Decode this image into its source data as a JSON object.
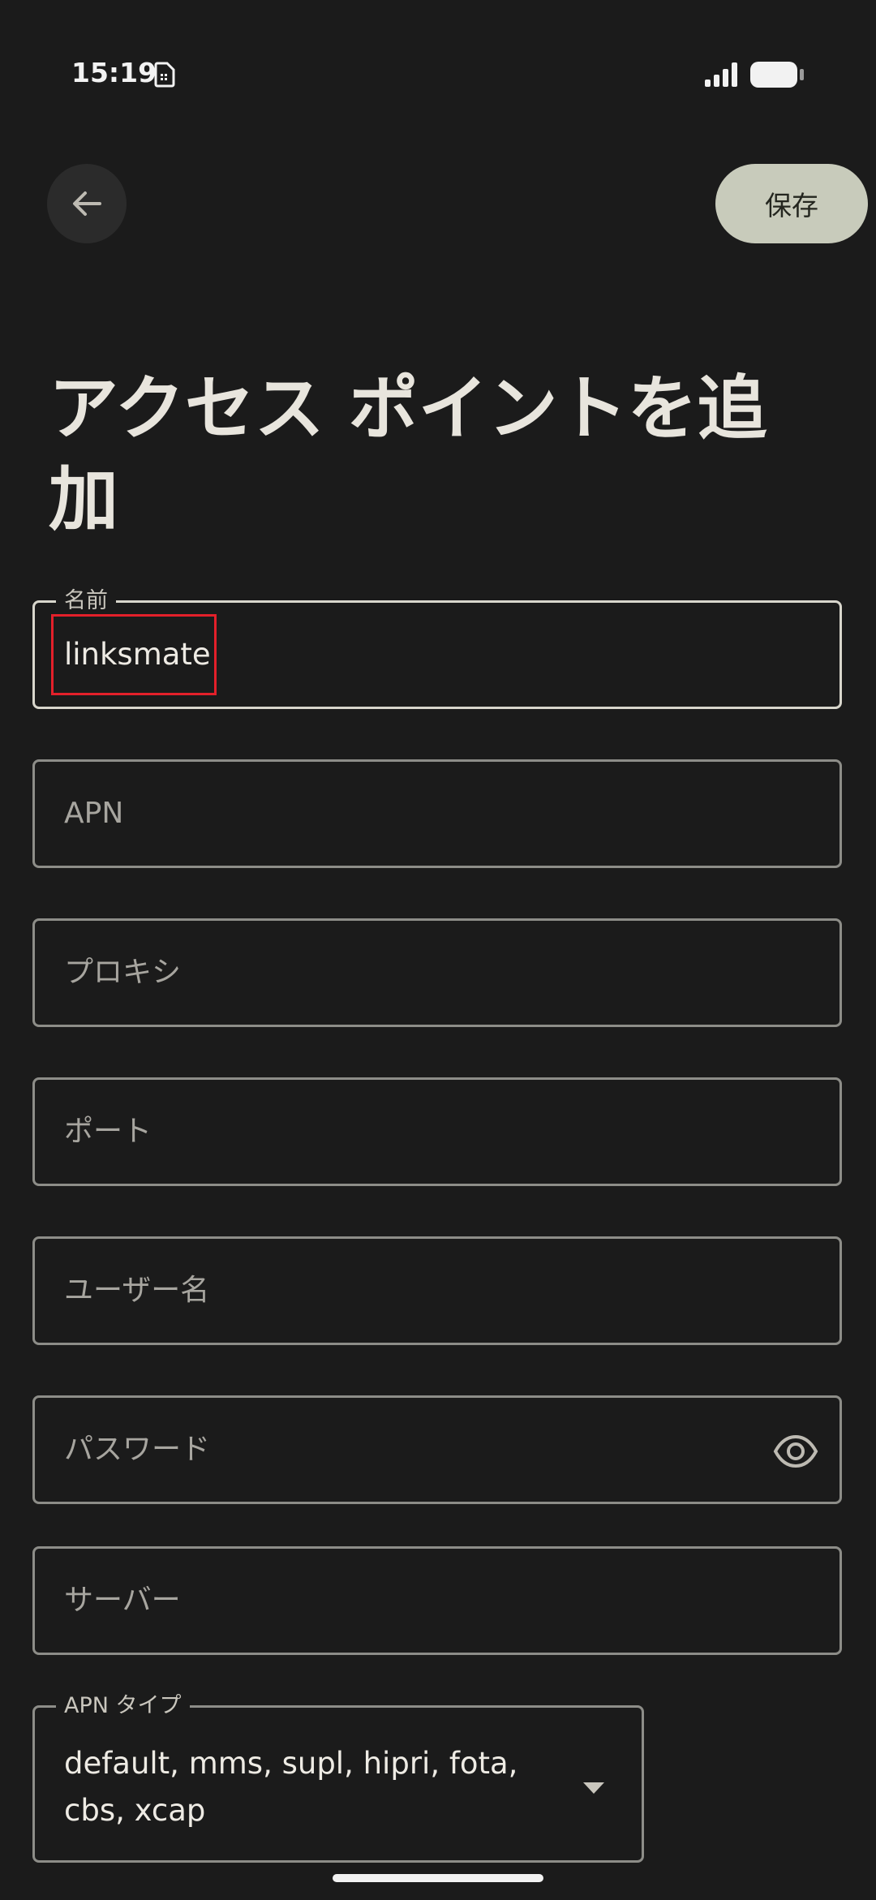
{
  "status_bar": {
    "time": "15:19",
    "sim_icon": "sim-card-icon",
    "signal_icon": "signal-bars-icon",
    "battery_icon": "battery-full-icon"
  },
  "header": {
    "back_icon": "arrow-left-icon",
    "save_label": "保存"
  },
  "title": "アクセス ポイントを追加",
  "fields": {
    "name": {
      "label": "名前",
      "value": "linksmate"
    },
    "apn": {
      "placeholder": "APN"
    },
    "proxy": {
      "placeholder": "プロキシ"
    },
    "port": {
      "placeholder": "ポート"
    },
    "username": {
      "placeholder": "ユーザー名"
    },
    "password": {
      "placeholder": "パスワード",
      "toggle_icon": "eye-icon"
    },
    "server": {
      "placeholder": "サーバー"
    },
    "apn_type": {
      "label": "APN タイプ",
      "value": "default, mms, supl, hipri, fota, cbs, xcap"
    }
  },
  "colors": {
    "background": "#1b1b1b",
    "save_button": "#c8cbbb",
    "highlight": "#e3202a"
  }
}
